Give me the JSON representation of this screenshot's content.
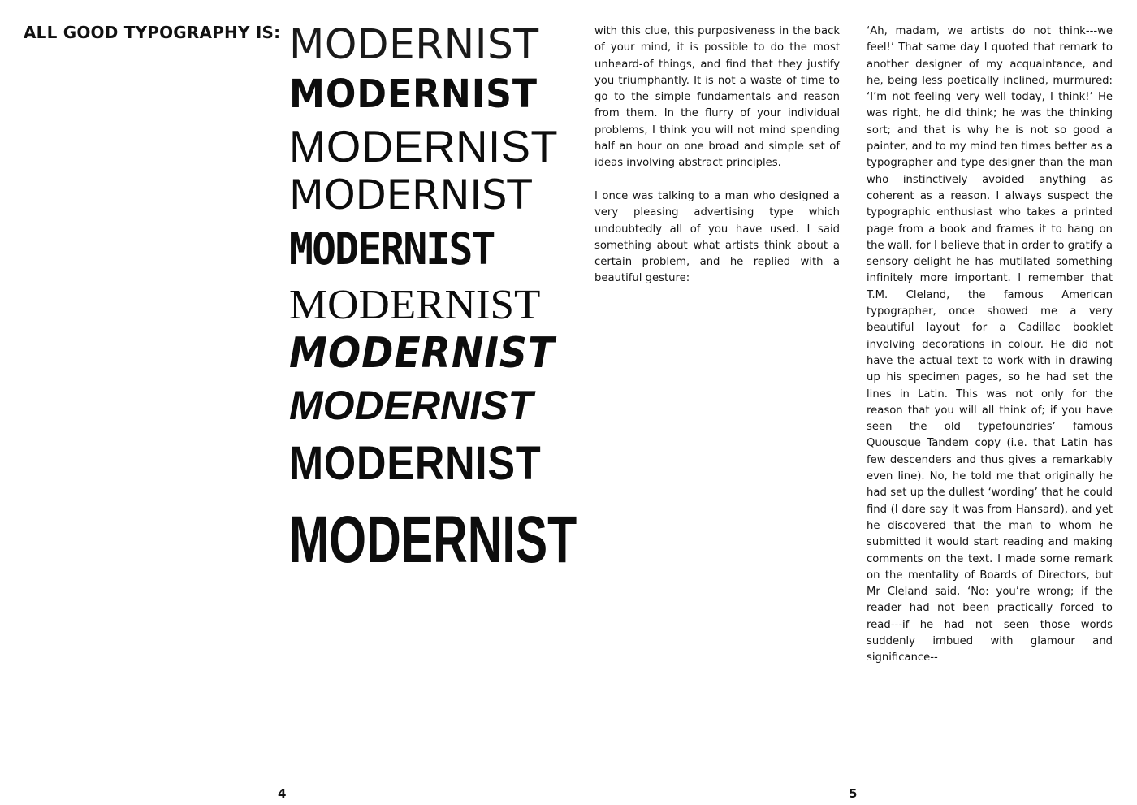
{
  "heading": "ALL GOOD TYPOGRAPHY IS:",
  "specimens": [
    "MODERNIST",
    "MODERNIST",
    "MODERNIST",
    "MODERNIST",
    "MODERNIST",
    "MODERNIST",
    "MODERNIST",
    "MODERNIST",
    "MODERNIST",
    "MODERNIST"
  ],
  "column_left": {
    "paragraphs": [
      "with this clue, this purposiveness in the back of your mind, it is possible to do the most unheard-of things, and find that they justify you triumphantly. It is not a waste of time to go to the simple fundamentals and reason from them. In the flurry of your individual problems, I think you will not mind spending half an hour on one broad and simple set of ideas involving abstract principles.",
      "I once was talking to a man who designed a very pleasing advertising type which undoubtedly all of you have used. I said something about what artists think about a certain problem, and he replied with a beautiful gesture:"
    ]
  },
  "column_right": {
    "paragraphs": [
      " ‘Ah, madam, we artists do not think---we feel!’ That same day I quoted that remark to another designer of my acquaintance, and he, being less poetically inclined, murmured: ‘I’m not feeling very well today, I think!’ He was right, he did think; he was the thinking sort; and that is why he is not so good a painter, and to my mind ten times better as a typographer and type designer than the man who instinctively avoided anything as coherent as a reason. I always suspect the typographic enthusiast who takes a printed page from a book and frames it to hang on the wall, for I believe that in order to gratify a sensory delight he has mutilated something infinitely more important. I remember that T.M. Cleland, the famous American typographer, once showed me a very beautiful layout for a Cadillac booklet involving decorations in colour. He did not have the actual text to work with in drawing up his specimen pages, so he had set the lines in Latin. This was not only for the reason that you will all think of; if you have seen the old typefoundries’ famous Quousque Tandem copy (i.e. that Latin has few descenders and thus gives a remarkably even line). No, he told me that originally he had set up the dullest ‘wording’ that he could find (I dare say it was from Hansard), and yet he discovered that the man to whom he submitted it would start reading and making comments on the text. I made some remark on the mentality of Boards of Directors, but Mr Cleland said, ‘No: you’re wrong; if the reader had not been practically forced to read---if he had not seen those words suddenly imbued with glamour and significance--"
    ]
  },
  "page_numbers": {
    "left": "4",
    "right": "5"
  }
}
